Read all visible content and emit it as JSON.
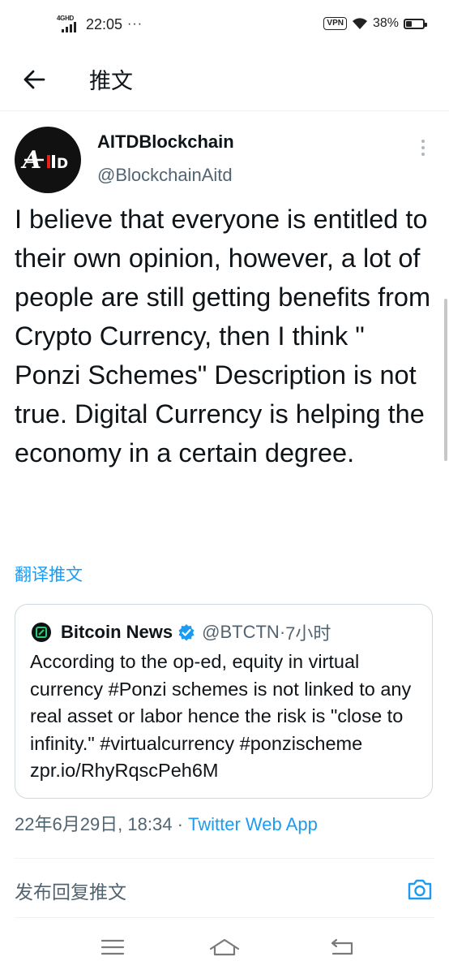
{
  "status_bar": {
    "network": "4GHD",
    "time": "22:05",
    "overflow": "···",
    "vpn": "VPN",
    "battery_percent": "38%",
    "battery_level": 0.38
  },
  "header": {
    "back_icon": "arrow-left-icon",
    "title": "推文"
  },
  "tweet": {
    "author_name": "AITDBlockchain",
    "author_handle": "@BlockchainAitd",
    "avatar_text": "AIID",
    "more_icon": "more-vertical-icon",
    "text": "I believe that everyone is entitled to their own opinion, however, a lot of people are still getting benefits from Crypto Currency, then I think \" Ponzi Schemes\" Description is not true. Digital Currency is helping the economy in a certain degree.",
    "translate_label": "翻译推文",
    "date": "22年6月29日, 18:34",
    "separator": " · ",
    "source": "Twitter Web App"
  },
  "quoted_tweet": {
    "name": "Bitcoin News",
    "verified_icon": "verified-badge-icon",
    "handle": "@BTCTN",
    "separator": " · ",
    "time": "7小时",
    "text": "According to the op-ed, equity in virtual currency #Ponzi schemes is not linked to any real asset or labor hence the risk is \"close to infinity.\" #virtualcurrency #ponzischeme zpr.io/RhyRqscPeh6M"
  },
  "reply_bar": {
    "placeholder": "发布回复推文",
    "camera_icon": "camera-icon"
  },
  "nav_bar": {
    "menu_icon": "menu-icon",
    "home_icon": "home-icon",
    "back_icon": "back-return-icon"
  },
  "colors": {
    "accent": "#1d9bf0",
    "text_primary": "#0f1419",
    "text_secondary": "#536471",
    "border": "#cfd9de"
  }
}
